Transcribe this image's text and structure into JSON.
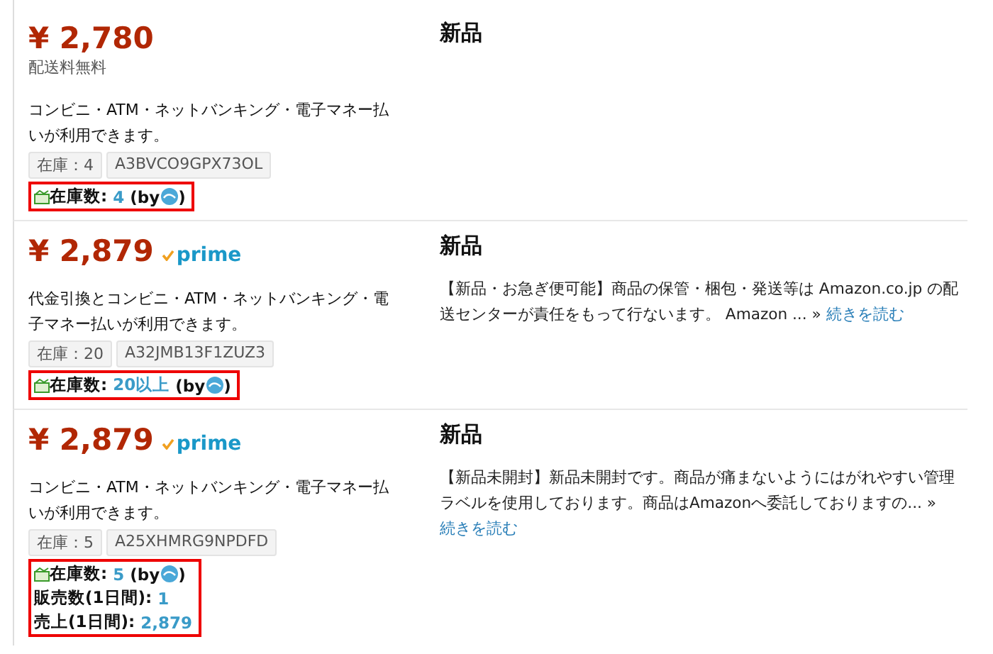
{
  "offers": [
    {
      "price": "¥ 2,780",
      "prime": false,
      "shipping": "配送料無料",
      "payment": "コンビニ・ATM・ネットバンキング・電子マネー払いが利用できます。",
      "stock_tag": "在庫：4",
      "seller_id": "A3BVCO9GPX73OL",
      "stock": {
        "label": "在庫数:",
        "value": "4",
        "by_open": "(by",
        "by_close": ")"
      },
      "condition": "新品"
    },
    {
      "price": "¥ 2,879",
      "prime": true,
      "prime_label": "prime",
      "payment": "代金引換とコンビニ・ATM・ネットバンキング・電子マネー払いが利用できます。",
      "stock_tag": "在庫：20",
      "seller_id": "A32JMB13F1ZUZ3",
      "stock": {
        "label": "在庫数:",
        "value": "20以上",
        "by_open": "(by",
        "by_close": ")"
      },
      "condition": "新品",
      "description": "【新品・お急ぎ便可能】商品の保管・梱包・発送等は Amazon.co.jp の配送センターが責任をもって行ないます。 Amazon ... »",
      "read_more": "続きを読む"
    },
    {
      "price": "¥ 2,879",
      "prime": true,
      "prime_label": "prime",
      "payment": "コンビニ・ATM・ネットバンキング・電子マネー払いが利用できます。",
      "stock_tag": "在庫：5",
      "seller_id": "A25XHMRG9NPDFD",
      "stock": {
        "label": "在庫数:",
        "value": "5",
        "by_open": "(by",
        "by_close": ")"
      },
      "stats": [
        {
          "label": "販売数(1日間):",
          "value": "1"
        },
        {
          "label": "売上(1日間):",
          "value": "2,879"
        }
      ],
      "condition": "新品",
      "description": "【新品未開封】新品未開封です。商品が痛まないようにはがれやすい管理ラベルを使用しております。商品はAmazonへ委託しておりますの... »",
      "read_more": "続きを読む"
    }
  ]
}
